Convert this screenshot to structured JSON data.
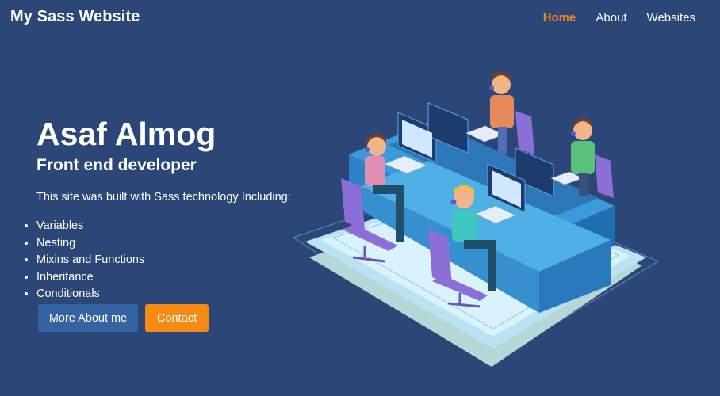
{
  "header": {
    "brand": "My Sass Website",
    "nav": [
      {
        "label": "Home",
        "active": true
      },
      {
        "label": "About",
        "active": false
      },
      {
        "label": "Websites",
        "active": false
      }
    ]
  },
  "hero": {
    "title": "Asaf Almog",
    "subtitle": "Front end developer",
    "intro": "This site was built with Sass technology Including:",
    "features": [
      "Variables",
      "Nesting",
      "Mixins and Functions",
      "Inheritance",
      "Conditionals"
    ],
    "buttons": {
      "primary": "More About me",
      "secondary": "Contact"
    }
  },
  "colors": {
    "background": "#2c4677",
    "accent": "#f0861b",
    "primary_button": "#3562a3",
    "secondary_button": "#f58a14"
  },
  "illustration": {
    "icon": "office-workers-illustration"
  }
}
